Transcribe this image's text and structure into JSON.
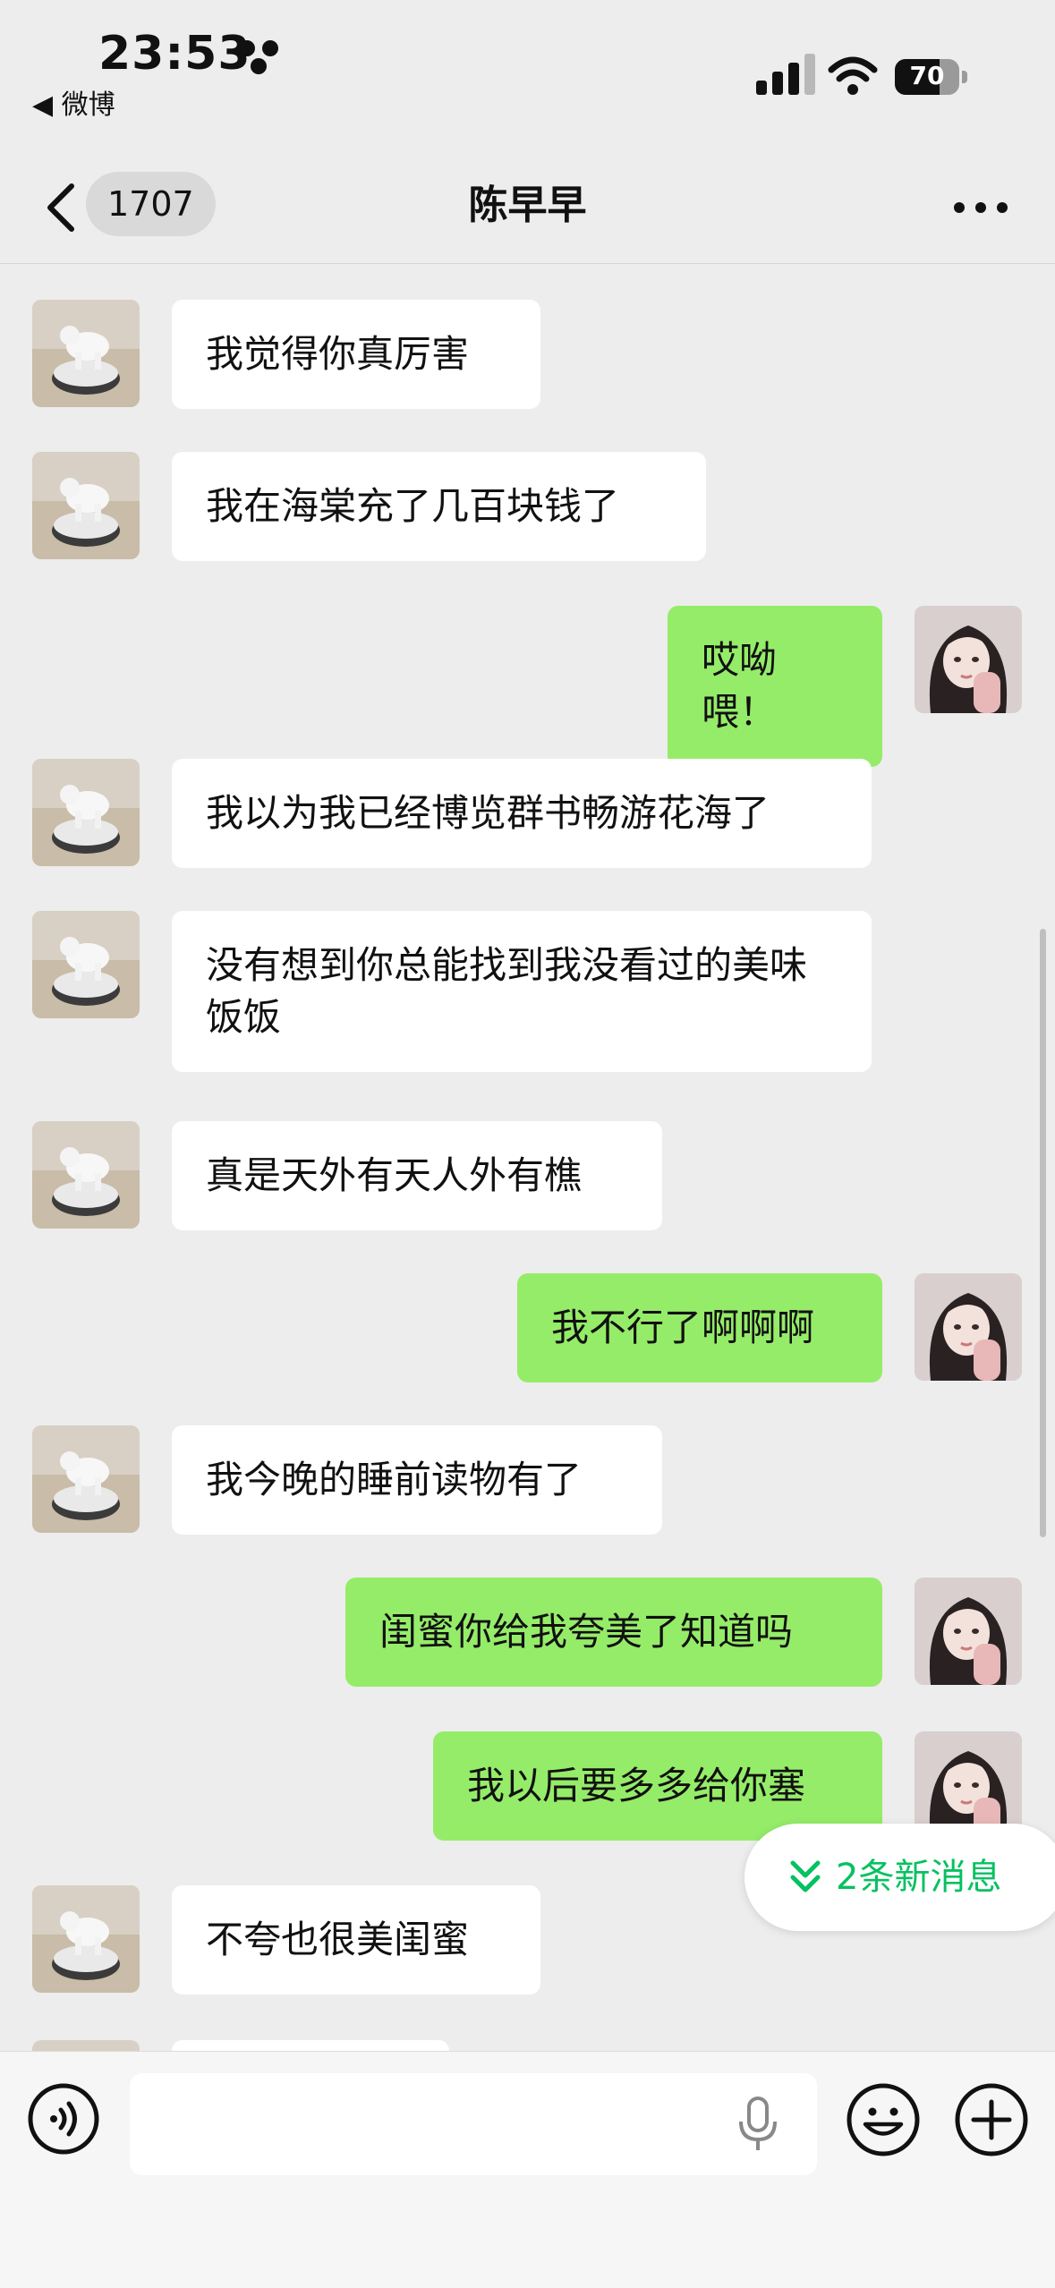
{
  "status_bar": {
    "time": "23:53",
    "back_app": "◀ 微博",
    "battery": "70",
    "battery_level": 0.7
  },
  "nav": {
    "unread_count": "1707",
    "title": "陈早早"
  },
  "messages": [
    {
      "side": "in",
      "text": "我觉得你真厉害"
    },
    {
      "side": "in",
      "text": "我在海棠充了几百块钱了"
    },
    {
      "side": "out",
      "text": "哎呦喂！"
    },
    {
      "side": "in",
      "text": "我以为我已经博览群书畅游花海了"
    },
    {
      "side": "in",
      "text": "没有想到你总能找到我没看过的美味饭饭"
    },
    {
      "side": "in",
      "text": "真是天外有天人外有樵"
    },
    {
      "side": "out",
      "text": "我不行了啊啊啊"
    },
    {
      "side": "in",
      "text": "我今晚的睡前读物有了"
    },
    {
      "side": "out",
      "text": "闺蜜你给我夸美了知道吗"
    },
    {
      "side": "out",
      "text": "我以后要多多给你塞"
    },
    {
      "side": "in",
      "text": "不夸也很美闺蜜"
    }
  ],
  "new_messages_label": "2条新消息",
  "input": {
    "value": "",
    "placeholder": ""
  },
  "colors": {
    "background": "#ededed",
    "outgoing_bubble": "#95ec69",
    "incoming_bubble": "#ffffff",
    "accent": "#07c160"
  },
  "icons": {
    "status": [
      "focus-icon",
      "signal-icon",
      "wifi-icon",
      "battery-icon"
    ],
    "nav": [
      "chevron-left-icon",
      "more-icon"
    ],
    "input": [
      "voice-icon",
      "microphone-icon",
      "emoji-icon",
      "plus-icon"
    ]
  }
}
